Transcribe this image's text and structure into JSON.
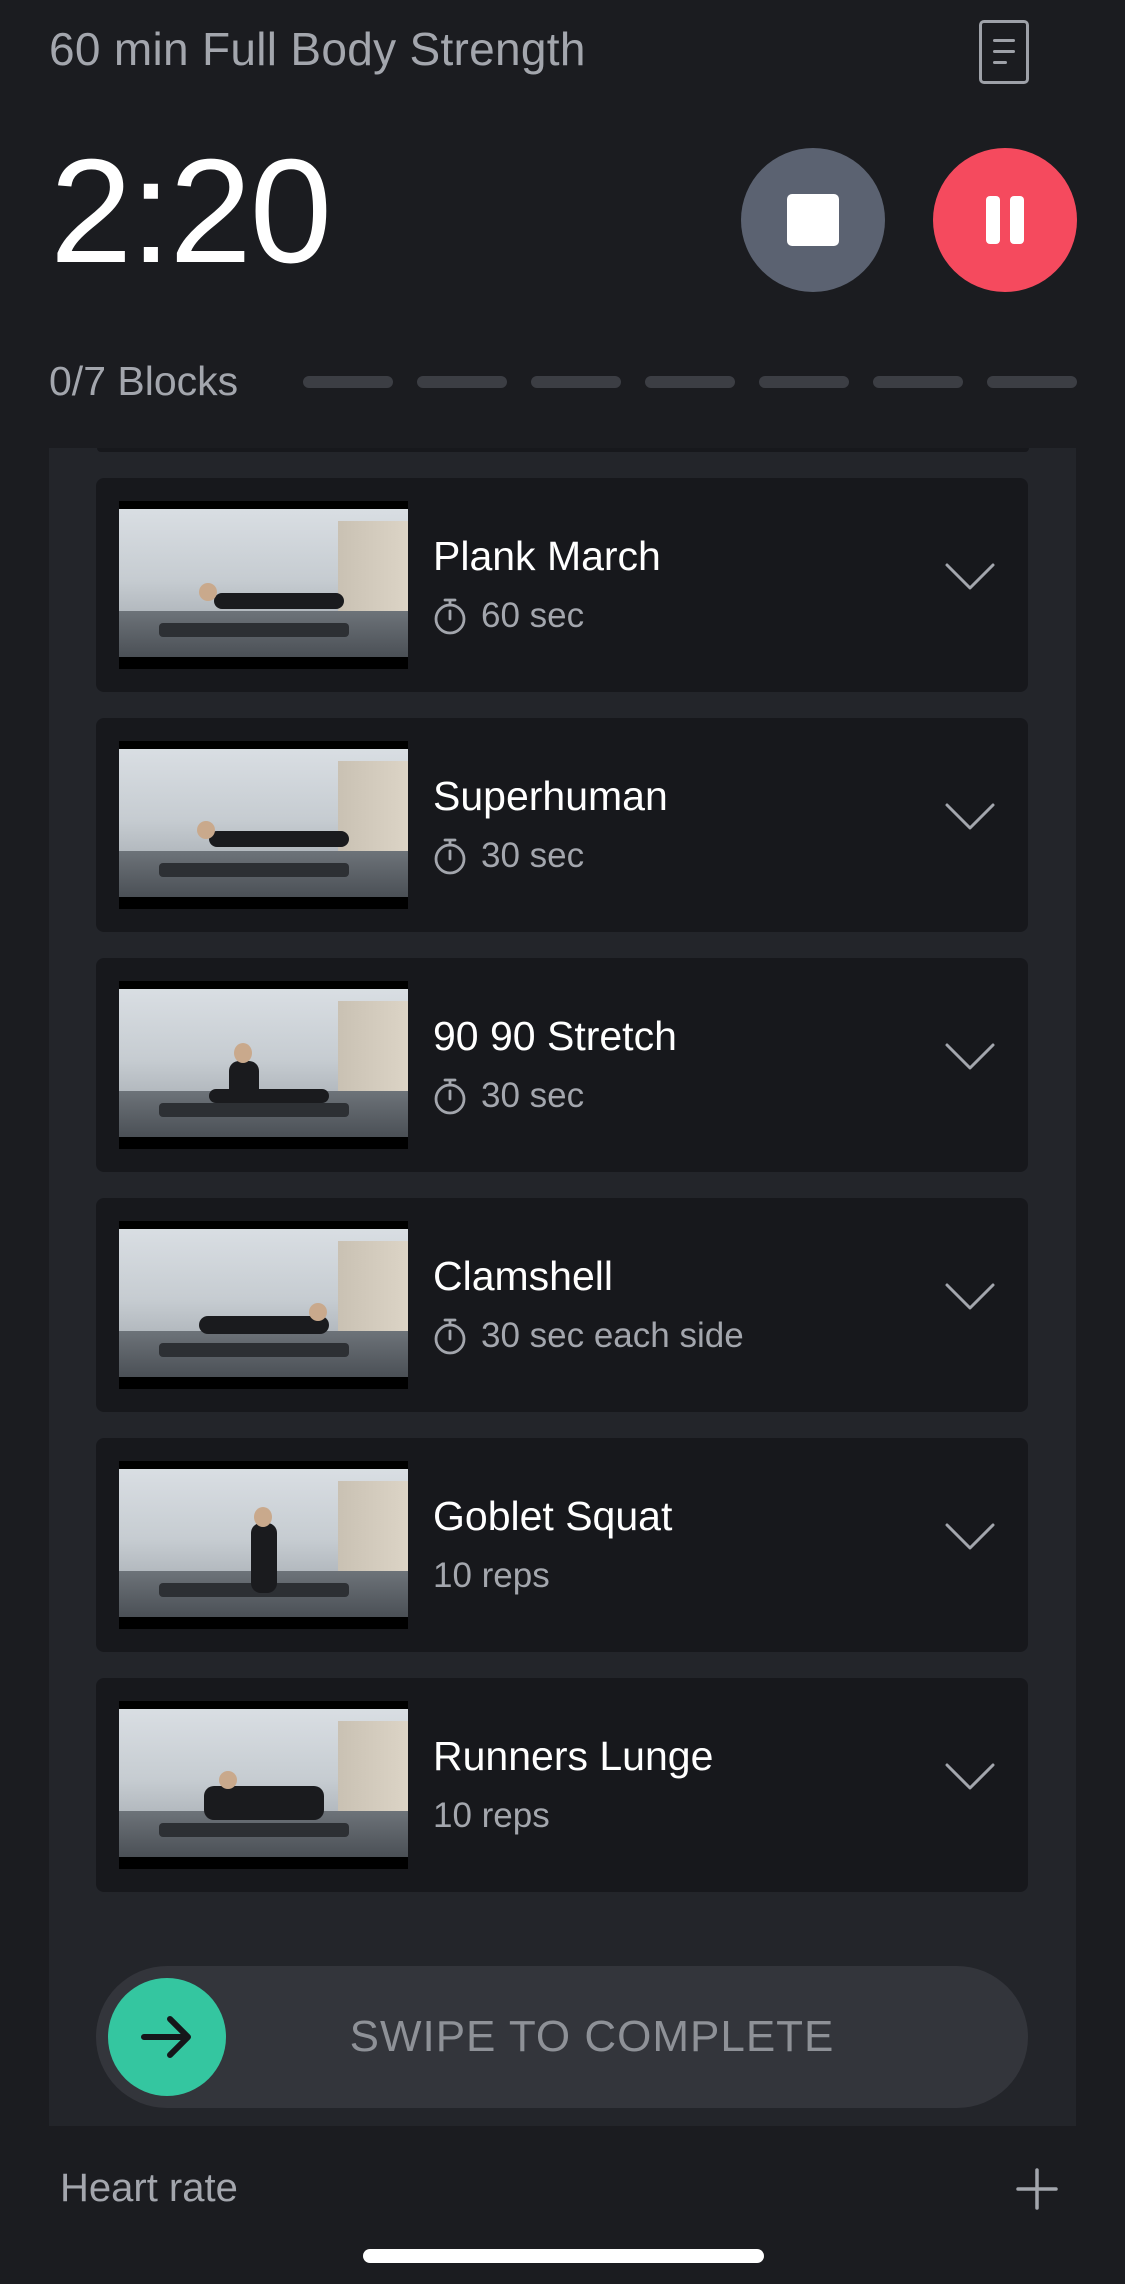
{
  "header": {
    "title": "60 min Full Body Strength",
    "notes_icon": "notes-icon"
  },
  "timer": {
    "value": "2:20"
  },
  "controls": {
    "stop_icon": "stop-icon",
    "pause_icon": "pause-icon",
    "stop_color": "#5b6271",
    "pause_color": "#f54a5e"
  },
  "progress": {
    "label": "0/7 Blocks",
    "completed": 0,
    "total": 7
  },
  "exercises": [
    {
      "name": "Plank March",
      "meta": "60 sec",
      "timed": true
    },
    {
      "name": "Superhuman",
      "meta": "30 sec",
      "timed": true
    },
    {
      "name": "90 90 Stretch",
      "meta": "30 sec",
      "timed": true
    },
    {
      "name": "Clamshell",
      "meta": "30 sec each side",
      "timed": true
    },
    {
      "name": "Goblet Squat",
      "meta": "10 reps",
      "timed": false
    },
    {
      "name": "Runners Lunge",
      "meta": "10 reps",
      "timed": false
    }
  ],
  "swipe": {
    "label": "SWIPE TO COMPLETE",
    "accent": "#34c6a0"
  },
  "footer": {
    "heart_rate_label": "Heart rate"
  }
}
